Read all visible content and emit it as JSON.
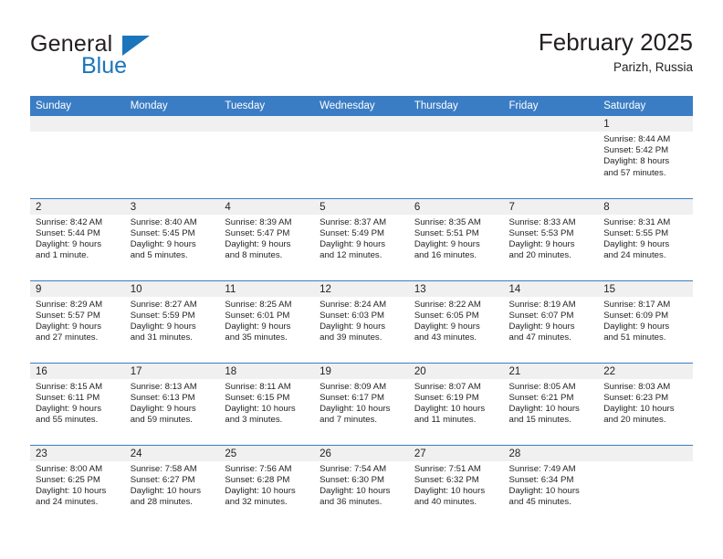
{
  "brand": {
    "name_part1": "General",
    "name_part2": "Blue",
    "accent_color": "#1b75bb"
  },
  "header": {
    "title": "February 2025",
    "subtitle": "Parizh, Russia"
  },
  "theme": {
    "header_bg": "#3b7dc4",
    "day_band_bg": "#f0f0f0",
    "text_color": "#231f20"
  },
  "calendar": {
    "weekday_headers": [
      "Sunday",
      "Monday",
      "Tuesday",
      "Wednesday",
      "Thursday",
      "Friday",
      "Saturday"
    ],
    "weeks": [
      [
        {
          "day": "",
          "blank": true
        },
        {
          "day": "",
          "blank": true
        },
        {
          "day": "",
          "blank": true
        },
        {
          "day": "",
          "blank": true
        },
        {
          "day": "",
          "blank": true
        },
        {
          "day": "",
          "blank": true
        },
        {
          "day": "1",
          "sunrise": "Sunrise: 8:44 AM",
          "sunset": "Sunset: 5:42 PM",
          "daylight_line1": "Daylight: 8 hours",
          "daylight_line2": "and 57 minutes."
        }
      ],
      [
        {
          "day": "2",
          "sunrise": "Sunrise: 8:42 AM",
          "sunset": "Sunset: 5:44 PM",
          "daylight_line1": "Daylight: 9 hours",
          "daylight_line2": "and 1 minute."
        },
        {
          "day": "3",
          "sunrise": "Sunrise: 8:40 AM",
          "sunset": "Sunset: 5:45 PM",
          "daylight_line1": "Daylight: 9 hours",
          "daylight_line2": "and 5 minutes."
        },
        {
          "day": "4",
          "sunrise": "Sunrise: 8:39 AM",
          "sunset": "Sunset: 5:47 PM",
          "daylight_line1": "Daylight: 9 hours",
          "daylight_line2": "and 8 minutes."
        },
        {
          "day": "5",
          "sunrise": "Sunrise: 8:37 AM",
          "sunset": "Sunset: 5:49 PM",
          "daylight_line1": "Daylight: 9 hours",
          "daylight_line2": "and 12 minutes."
        },
        {
          "day": "6",
          "sunrise": "Sunrise: 8:35 AM",
          "sunset": "Sunset: 5:51 PM",
          "daylight_line1": "Daylight: 9 hours",
          "daylight_line2": "and 16 minutes."
        },
        {
          "day": "7",
          "sunrise": "Sunrise: 8:33 AM",
          "sunset": "Sunset: 5:53 PM",
          "daylight_line1": "Daylight: 9 hours",
          "daylight_line2": "and 20 minutes."
        },
        {
          "day": "8",
          "sunrise": "Sunrise: 8:31 AM",
          "sunset": "Sunset: 5:55 PM",
          "daylight_line1": "Daylight: 9 hours",
          "daylight_line2": "and 24 minutes."
        }
      ],
      [
        {
          "day": "9",
          "sunrise": "Sunrise: 8:29 AM",
          "sunset": "Sunset: 5:57 PM",
          "daylight_line1": "Daylight: 9 hours",
          "daylight_line2": "and 27 minutes."
        },
        {
          "day": "10",
          "sunrise": "Sunrise: 8:27 AM",
          "sunset": "Sunset: 5:59 PM",
          "daylight_line1": "Daylight: 9 hours",
          "daylight_line2": "and 31 minutes."
        },
        {
          "day": "11",
          "sunrise": "Sunrise: 8:25 AM",
          "sunset": "Sunset: 6:01 PM",
          "daylight_line1": "Daylight: 9 hours",
          "daylight_line2": "and 35 minutes."
        },
        {
          "day": "12",
          "sunrise": "Sunrise: 8:24 AM",
          "sunset": "Sunset: 6:03 PM",
          "daylight_line1": "Daylight: 9 hours",
          "daylight_line2": "and 39 minutes."
        },
        {
          "day": "13",
          "sunrise": "Sunrise: 8:22 AM",
          "sunset": "Sunset: 6:05 PM",
          "daylight_line1": "Daylight: 9 hours",
          "daylight_line2": "and 43 minutes."
        },
        {
          "day": "14",
          "sunrise": "Sunrise: 8:19 AM",
          "sunset": "Sunset: 6:07 PM",
          "daylight_line1": "Daylight: 9 hours",
          "daylight_line2": "and 47 minutes."
        },
        {
          "day": "15",
          "sunrise": "Sunrise: 8:17 AM",
          "sunset": "Sunset: 6:09 PM",
          "daylight_line1": "Daylight: 9 hours",
          "daylight_line2": "and 51 minutes."
        }
      ],
      [
        {
          "day": "16",
          "sunrise": "Sunrise: 8:15 AM",
          "sunset": "Sunset: 6:11 PM",
          "daylight_line1": "Daylight: 9 hours",
          "daylight_line2": "and 55 minutes."
        },
        {
          "day": "17",
          "sunrise": "Sunrise: 8:13 AM",
          "sunset": "Sunset: 6:13 PM",
          "daylight_line1": "Daylight: 9 hours",
          "daylight_line2": "and 59 minutes."
        },
        {
          "day": "18",
          "sunrise": "Sunrise: 8:11 AM",
          "sunset": "Sunset: 6:15 PM",
          "daylight_line1": "Daylight: 10 hours",
          "daylight_line2": "and 3 minutes."
        },
        {
          "day": "19",
          "sunrise": "Sunrise: 8:09 AM",
          "sunset": "Sunset: 6:17 PM",
          "daylight_line1": "Daylight: 10 hours",
          "daylight_line2": "and 7 minutes."
        },
        {
          "day": "20",
          "sunrise": "Sunrise: 8:07 AM",
          "sunset": "Sunset: 6:19 PM",
          "daylight_line1": "Daylight: 10 hours",
          "daylight_line2": "and 11 minutes."
        },
        {
          "day": "21",
          "sunrise": "Sunrise: 8:05 AM",
          "sunset": "Sunset: 6:21 PM",
          "daylight_line1": "Daylight: 10 hours",
          "daylight_line2": "and 15 minutes."
        },
        {
          "day": "22",
          "sunrise": "Sunrise: 8:03 AM",
          "sunset": "Sunset: 6:23 PM",
          "daylight_line1": "Daylight: 10 hours",
          "daylight_line2": "and 20 minutes."
        }
      ],
      [
        {
          "day": "23",
          "sunrise": "Sunrise: 8:00 AM",
          "sunset": "Sunset: 6:25 PM",
          "daylight_line1": "Daylight: 10 hours",
          "daylight_line2": "and 24 minutes."
        },
        {
          "day": "24",
          "sunrise": "Sunrise: 7:58 AM",
          "sunset": "Sunset: 6:27 PM",
          "daylight_line1": "Daylight: 10 hours",
          "daylight_line2": "and 28 minutes."
        },
        {
          "day": "25",
          "sunrise": "Sunrise: 7:56 AM",
          "sunset": "Sunset: 6:28 PM",
          "daylight_line1": "Daylight: 10 hours",
          "daylight_line2": "and 32 minutes."
        },
        {
          "day": "26",
          "sunrise": "Sunrise: 7:54 AM",
          "sunset": "Sunset: 6:30 PM",
          "daylight_line1": "Daylight: 10 hours",
          "daylight_line2": "and 36 minutes."
        },
        {
          "day": "27",
          "sunrise": "Sunrise: 7:51 AM",
          "sunset": "Sunset: 6:32 PM",
          "daylight_line1": "Daylight: 10 hours",
          "daylight_line2": "and 40 minutes."
        },
        {
          "day": "28",
          "sunrise": "Sunrise: 7:49 AM",
          "sunset": "Sunset: 6:34 PM",
          "daylight_line1": "Daylight: 10 hours",
          "daylight_line2": "and 45 minutes."
        },
        {
          "day": "",
          "blank": true
        }
      ]
    ]
  }
}
